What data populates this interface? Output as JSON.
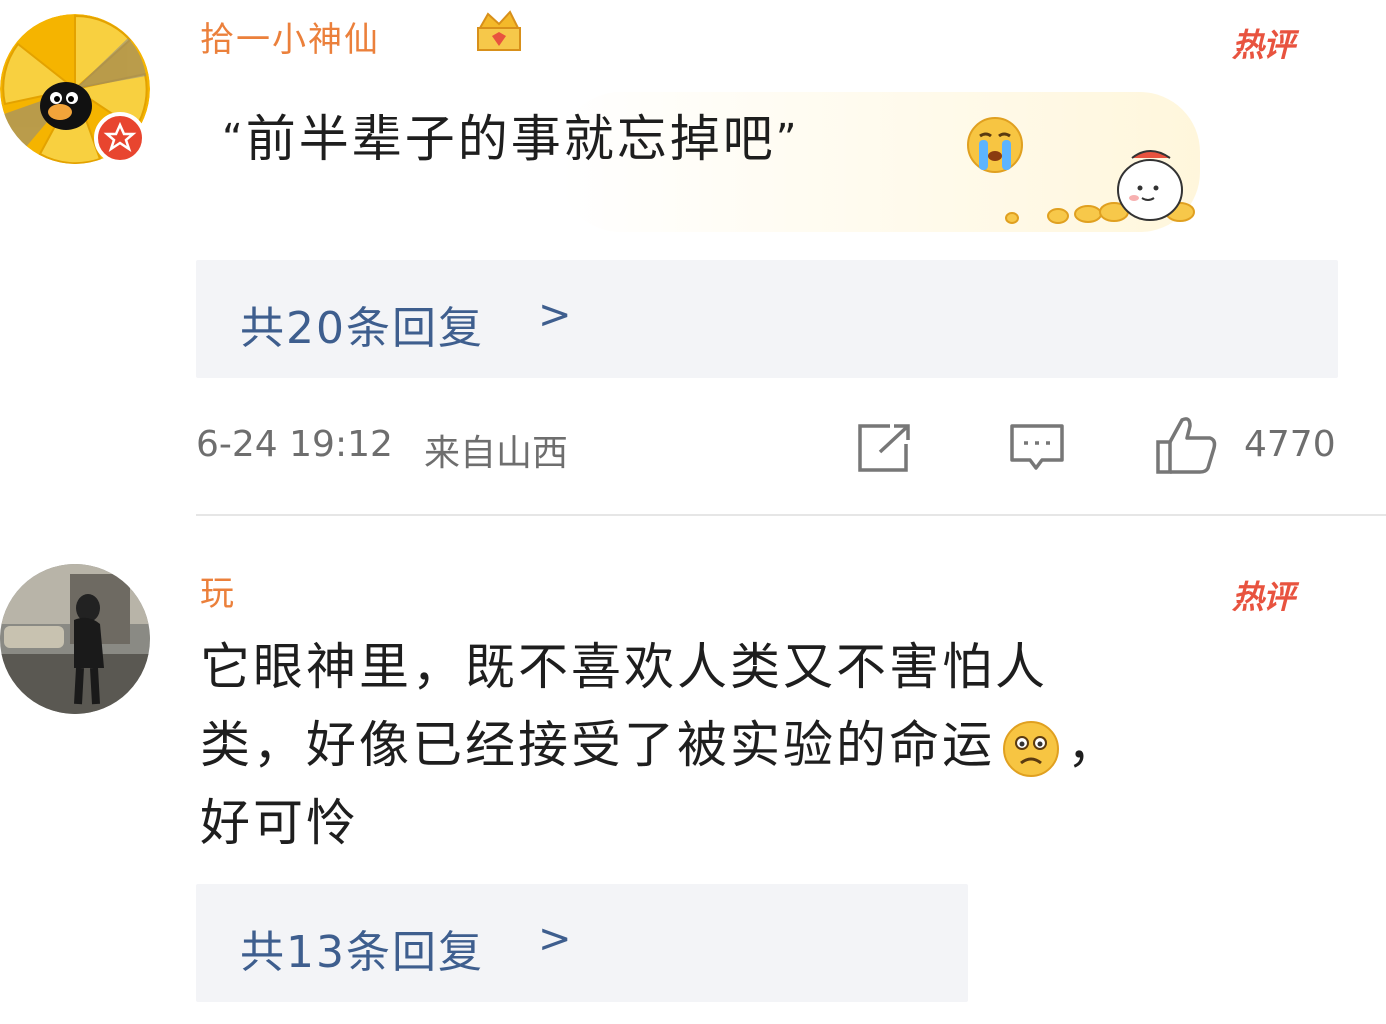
{
  "comments": [
    {
      "username": "拾一小神仙",
      "badge": "热评",
      "text_open_quote": "“",
      "text": "前半辈子的事就忘掉吧",
      "text_close_quote": "”",
      "emoji": "crying-face",
      "replies_label": "共20条回复",
      "replies_chevron": ">",
      "timestamp": "6-24 19:12",
      "location": "来自山西",
      "like_count": "4770"
    },
    {
      "username": "玩",
      "badge": "热评",
      "text_line1": "它眼神里，既不喜欢人类又不害怕人",
      "text_line2": "类，好像已经接受了被实验的命运",
      "text_line2_tail": "，",
      "text_line3": "好可怜",
      "emoji": "sad-face",
      "replies_label": "共13条回复",
      "replies_chevron": ">"
    }
  ],
  "colors": {
    "username": "#e86a1a",
    "badge": "#e8533f",
    "reply_link": "#3e5e8e",
    "reply_bg": "#f3f4f7",
    "meta": "#6e6e6e"
  }
}
